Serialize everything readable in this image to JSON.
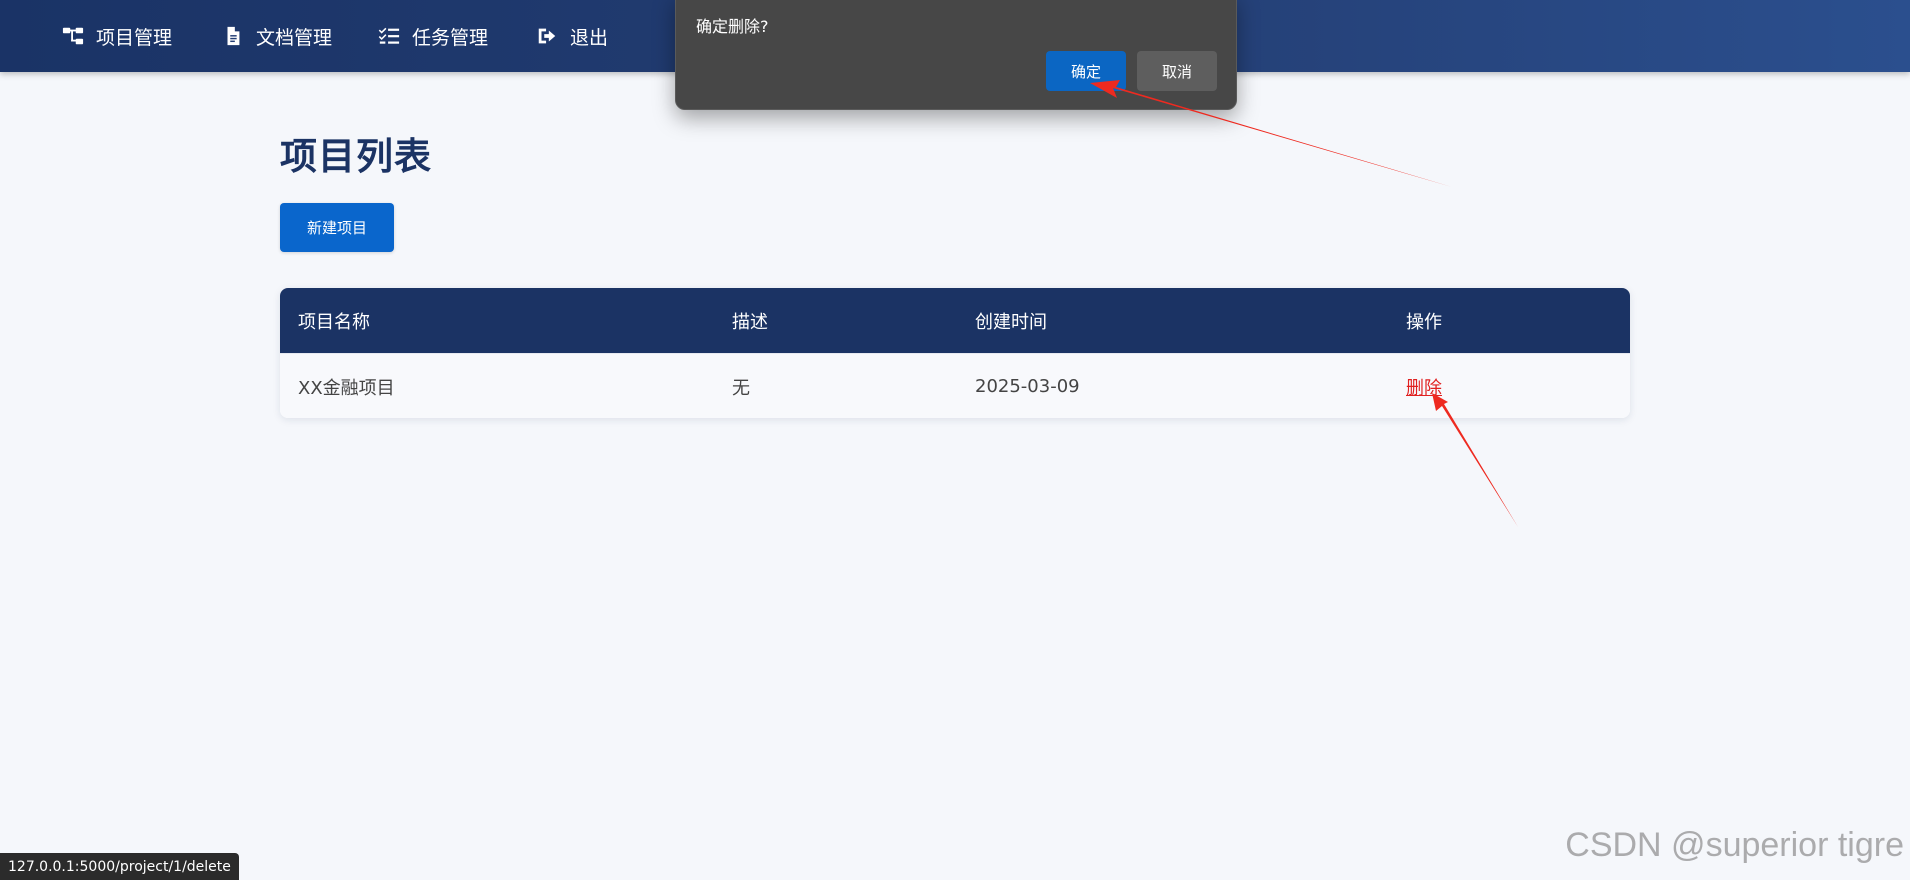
{
  "nav": {
    "items": [
      {
        "label": "项目管理",
        "icon": "sitemap-icon"
      },
      {
        "label": "文档管理",
        "icon": "file-icon"
      },
      {
        "label": "任务管理",
        "icon": "tasks-icon"
      },
      {
        "label": "退出",
        "icon": "sign-out-icon"
      }
    ]
  },
  "main": {
    "title": "项目列表",
    "new_button_label": "新建项目"
  },
  "table": {
    "headers": [
      "项目名称",
      "描述",
      "创建时间",
      "操作"
    ],
    "rows": [
      {
        "name": "XX金融项目",
        "description": "无",
        "created": "2025-03-09",
        "action": "删除"
      }
    ]
  },
  "dialog": {
    "message": "确定删除?",
    "ok_label": "确定",
    "cancel_label": "取消"
  },
  "statusbar": {
    "url": "127.0.0.1:5000/project/1/delete"
  },
  "watermark": "CSDN @superior tigre",
  "colors": {
    "nav_bg": "#1a3366",
    "primary": "#0a66cc",
    "table_header": "#1b3364",
    "delete_link": "#e02020",
    "annotation_arrow": "#ee2a20"
  }
}
